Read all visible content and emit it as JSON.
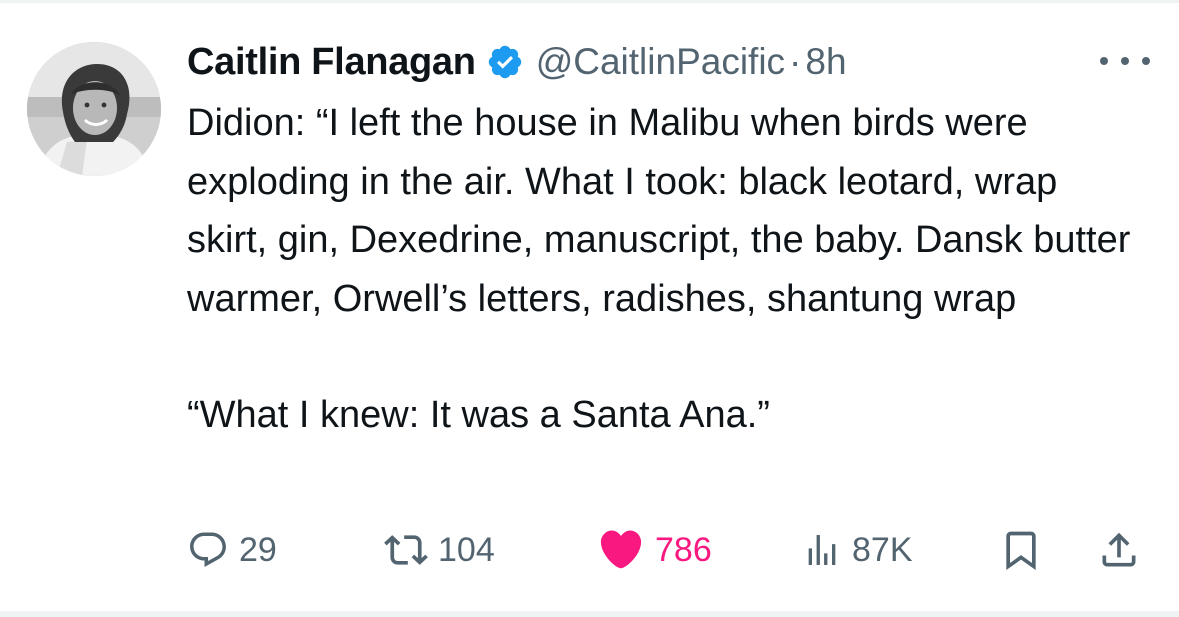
{
  "tweet": {
    "author": {
      "name": "Caitlin Flanagan",
      "handle": "@CaitlinPacific",
      "verified": true,
      "avatar_icon": "profile-photo"
    },
    "time_separator": "·",
    "time": "8h",
    "more_icon": "more-horizontal-icon",
    "text_paragraphs": [
      "Didion: “I left the house in Malibu when birds were exploding in the air. What I took:  black leotard, wrap skirt, gin, Dexedrine, manuscript, the baby. Dansk butter warmer, Orwell’s letters, radishes, shantung wrap",
      "“What I knew:  It was a Santa Ana.”"
    ],
    "stats": {
      "replies": "29",
      "reposts": "104",
      "likes": "786",
      "views": "87K"
    },
    "liked": true
  },
  "colors": {
    "text_primary": "#0f1419",
    "text_secondary": "#536471",
    "verified_blue": "#1d9bf0",
    "like_pink": "#f91880",
    "divider": "#eff3f4"
  }
}
